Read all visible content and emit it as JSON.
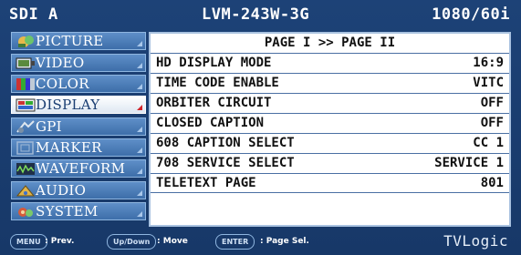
{
  "header": {
    "input": "SDI A",
    "model": "LVM-243W-3G",
    "format": "1080/60i"
  },
  "menu": {
    "items": [
      {
        "label": "PICTURE",
        "icon": "picture-icon",
        "active": false
      },
      {
        "label": "VIDEO",
        "icon": "video-icon",
        "active": false
      },
      {
        "label": "COLOR",
        "icon": "color-icon",
        "active": false
      },
      {
        "label": "DISPLAY",
        "icon": "display-icon",
        "active": true
      },
      {
        "label": "GPI",
        "icon": "gpi-icon",
        "active": false
      },
      {
        "label": "MARKER",
        "icon": "marker-icon",
        "active": false
      },
      {
        "label": "WAVEFORM",
        "icon": "waveform-icon",
        "active": false
      },
      {
        "label": "AUDIO",
        "icon": "audio-icon",
        "active": false
      },
      {
        "label": "SYSTEM",
        "icon": "system-icon",
        "active": false
      }
    ]
  },
  "panel": {
    "page_title": "PAGE I >> PAGE II",
    "rows": [
      {
        "label": "HD DISPLAY MODE",
        "value": "16:9"
      },
      {
        "label": "TIME CODE ENABLE",
        "value": "VITC"
      },
      {
        "label": "ORBITER CIRCUIT",
        "value": "OFF"
      },
      {
        "label": "CLOSED CAPTION",
        "value": "OFF"
      },
      {
        "label": "608 CAPTION SELECT",
        "value": "CC 1"
      },
      {
        "label": "708 SERVICE SELECT",
        "value": "SERVICE 1"
      },
      {
        "label": "TELETEXT PAGE",
        "value": "801"
      }
    ]
  },
  "footer": {
    "menu_key": "MENU",
    "menu_text": ": Prev.",
    "updown_key": "Up/Down",
    "updown_text": ": Move",
    "enter_key": "ENTER",
    "enter_text": ": Page Sel.",
    "brand": "TVLogic"
  },
  "colors": {
    "background": "#1b3f73",
    "menu_item": "#4f80bd",
    "active_corner": "#d2242a",
    "panel": "#ffffff"
  }
}
